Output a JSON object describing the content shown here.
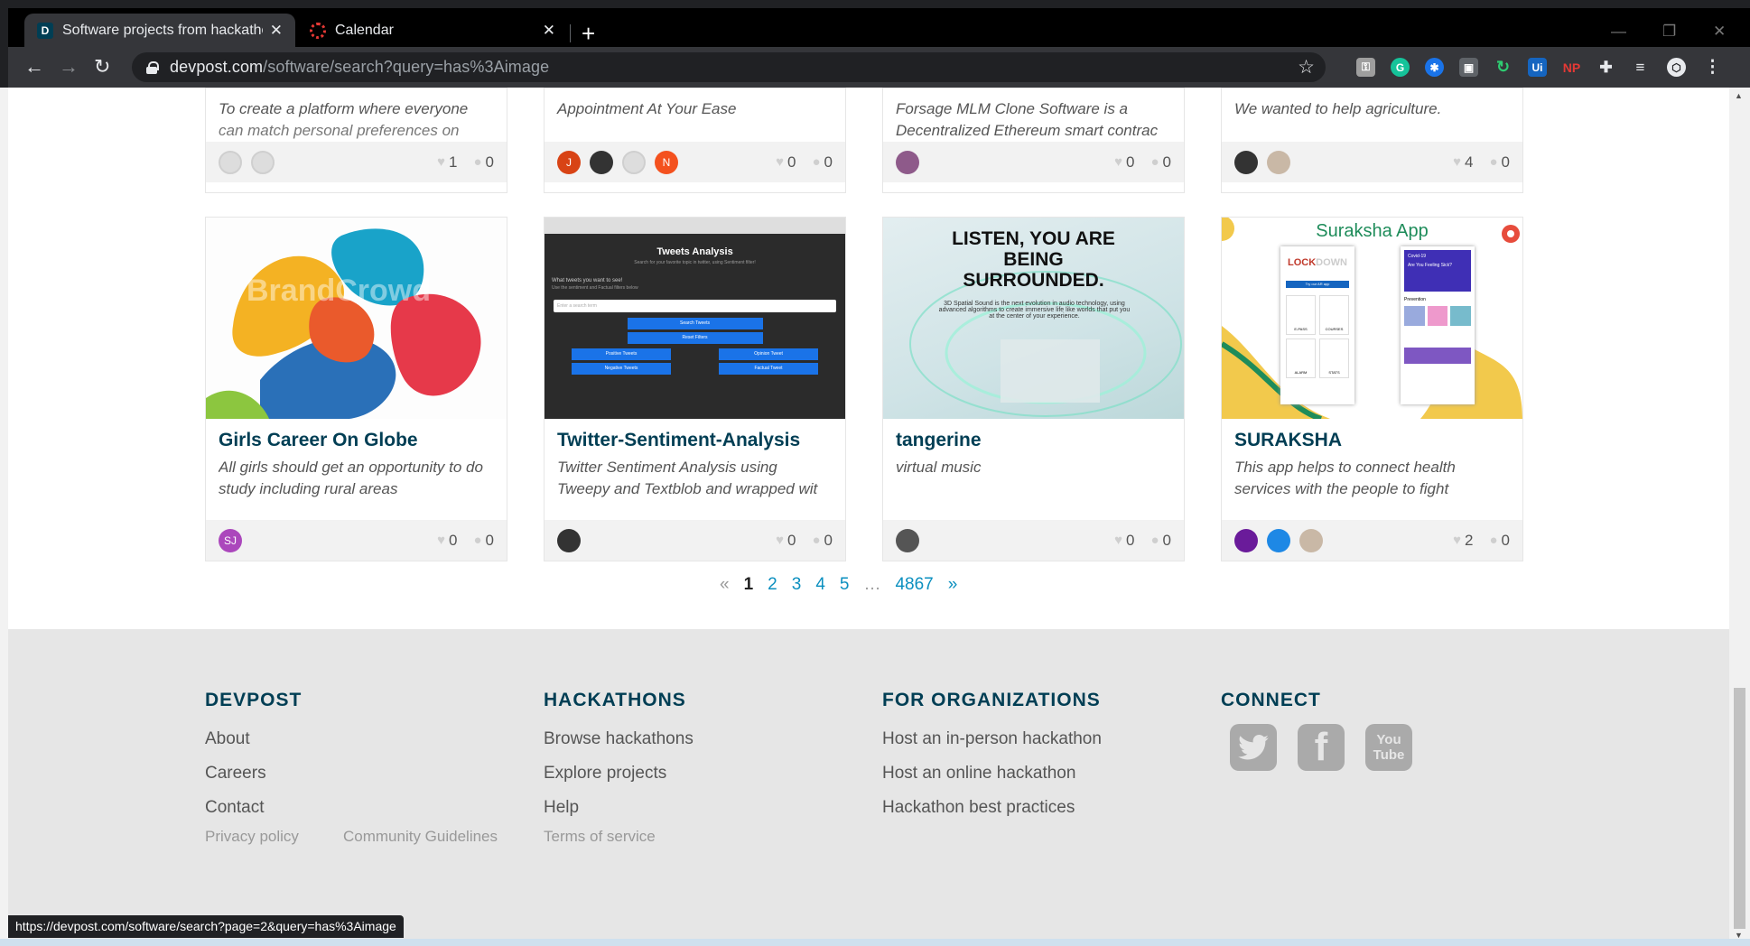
{
  "browser": {
    "tabs": [
      {
        "title": "Software projects from hackathons",
        "favicon": "D"
      },
      {
        "title": "Calendar"
      }
    ],
    "url_host": "devpost.com",
    "url_path": "/software/search?query=has%3Aimage",
    "extensions": [
      "Ui",
      "NP"
    ],
    "status_url": "https://devpost.com/software/search?page=2&query=has%3Aimage"
  },
  "top_cards": [
    {
      "tagline_1": "To create a platform where everyone",
      "tagline_2": "can match personal preferences on",
      "likes": "1",
      "comments": "0",
      "avatars": [
        "grey",
        "grey"
      ]
    },
    {
      "tagline_1": "Appointment At Your Ease",
      "tagline_2": "",
      "likes": "0",
      "comments": "0",
      "avatars": [
        "J",
        "photo",
        "grey",
        "N"
      ]
    },
    {
      "tagline_1": "Forsage MLM Clone Software is a",
      "tagline_2": "Decentralized Ethereum smart contrac",
      "likes": "0",
      "comments": "0",
      "avatars": [
        "photo"
      ]
    },
    {
      "tagline_1": "We wanted to help agriculture.",
      "tagline_2": "",
      "likes": "4",
      "comments": "0",
      "avatars": [
        "photo",
        "photo"
      ]
    }
  ],
  "cards": [
    {
      "title": "Girls Career On Globe",
      "tagline_1": "All girls should get an opportunity to do",
      "tagline_2": "study including rural areas",
      "likes": "0",
      "comments": "0",
      "avatar_initials": "SJ",
      "image_text": "BrandCrowd"
    },
    {
      "title": "Twitter-Sentiment-Analysis",
      "tagline_1": "Twitter Sentiment Analysis using",
      "tagline_2": "Tweepy and Textblob and wrapped wit",
      "likes": "0",
      "comments": "0",
      "shot": {
        "title": "Tweets Analysis",
        "subtitle": "Search for your favorite topic in twitter, using Sentiment filter!",
        "question": "What tweets you want to see!",
        "hint": "Use the sentiment and Factual filters below",
        "placeholder": "Enter a search term",
        "btn_search": "Search Tweets",
        "btn_reset": "Reset Filters",
        "btn_pos": "Positive Tweets",
        "btn_opinion": "Opinion Tweet",
        "btn_neg": "Negative Tweets",
        "btn_factual": "Factual Tweet"
      }
    },
    {
      "title": "tangerine",
      "tagline_1": "virtual music",
      "tagline_2": "",
      "likes": "0",
      "comments": "0",
      "shot": {
        "headline_1": "LISTEN, YOU ARE",
        "headline_2": "BEING",
        "headline_3": "SURROUNDED.",
        "body": "3D Spatial Sound is the next evolution in audio technology, using advanced algorithms to create immersive life like worlds that put you at the center of your experience."
      }
    },
    {
      "title": "SURAKSHA",
      "tagline_1": "This app helps to connect health",
      "tagline_2": "services with the people to fight",
      "likes": "2",
      "comments": "0",
      "shot": {
        "app_title": "Suraksha App",
        "lock": "LOCK",
        "down": "DOWN",
        "try": "Try our AR app",
        "covid": "Covid-19",
        "sick": "Are You Feeling Sick?",
        "prevention": "Prevention",
        "tiles": [
          "E-PASS",
          "COURSES",
          "ALARM",
          "STATS"
        ]
      }
    }
  ],
  "pagination": {
    "prev": "«",
    "pages": [
      "1",
      "2",
      "3",
      "4",
      "5"
    ],
    "ellipsis": "…",
    "last": "4867",
    "next": "»"
  },
  "footer": {
    "devpost": {
      "heading": "DEVPOST",
      "links": [
        "About",
        "Careers",
        "Contact"
      ]
    },
    "hackathons": {
      "heading": "HACKATHONS",
      "links": [
        "Browse hackathons",
        "Explore projects",
        "Help"
      ]
    },
    "organizations": {
      "heading": "FOR ORGANIZATIONS",
      "links": [
        "Host an in-person hackathon",
        "Host an online hackathon",
        "Hackathon best practices"
      ]
    },
    "connect": {
      "heading": "CONNECT",
      "icons": [
        "twitter-icon",
        "facebook-icon",
        "youtube-icon"
      ],
      "youtube_top": "You",
      "youtube_bottom": "Tube"
    },
    "legal": [
      "Privacy policy",
      "Community Guidelines",
      "Terms of service"
    ]
  },
  "colors": {
    "brand": "#003e54",
    "link": "#0b8fbf",
    "footer_bg": "#e6e6e6"
  }
}
